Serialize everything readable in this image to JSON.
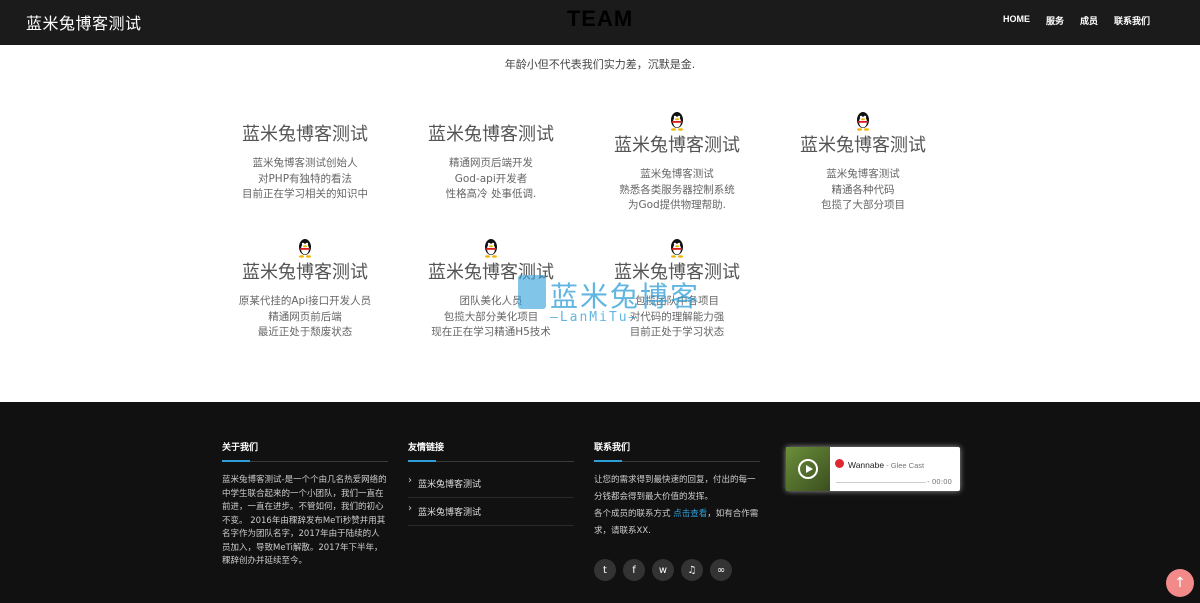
{
  "header": {
    "brand": "蓝米兔博客测试",
    "title": "TEAM",
    "nav": [
      "HOME",
      "服务",
      "成员",
      "联系我们"
    ]
  },
  "tagline": "年龄小但不代表我们实力差，沉默是金.",
  "members": [
    {
      "name": "蓝米兔博客测试",
      "lines": [
        "蓝米兔博客测试创始人",
        "对PHP有独特的看法",
        "目前正在学习相关的知识中"
      ],
      "avatar": false
    },
    {
      "name": "蓝米兔博客测试",
      "lines": [
        "精通网页后端开发",
        "God-api开发者",
        "性格高冷 处事低调."
      ],
      "avatar": false
    },
    {
      "name": "蓝米兔博客测试",
      "lines": [
        "蓝米兔博客测试",
        "熟悉各类服务器控制系统",
        "为God提供物理帮助."
      ],
      "avatar": true
    },
    {
      "name": "蓝米兔博客测试",
      "lines": [
        "蓝米兔博客测试",
        "精通各种代码",
        "包揽了大部分项目"
      ],
      "avatar": true
    },
    {
      "name": "蓝米兔博客测试",
      "lines": [
        "原某代挂的Api接口开发人员",
        "精通网页前后端",
        "最近正处于颓废状态"
      ],
      "avatar": true
    },
    {
      "name": "蓝米兔博客测试",
      "lines": [
        "团队美化人员",
        "包揽大部分美化项目",
        "现在正在学习精通H5技术"
      ],
      "avatar": true
    },
    {
      "name": "蓝米兔博客测试",
      "lines": [
        "包揽团队中各项目",
        "对代码的理解能力强",
        "目前正处于学习状态"
      ],
      "avatar": true
    }
  ],
  "watermark": {
    "main": "蓝米兔博客",
    "sub": "—LanMiTu—"
  },
  "footer": {
    "about_title": "关于我们",
    "about_text": "蓝米兔博客测试-是一个个由几名热爱网络的中学生联合起来的一个小团队，我们一直在前进，一直在进步。不管如何，我们的初心不变。 2016年由稞辞发布MeTi秒赞并用其名字作为团队名字，2017年由于陆续的人员加入，导致MeTi解散。2017年下半年，稞辞创办并延续至今。",
    "links_title": "友情链接",
    "links": [
      "蓝米兔博客测试",
      "蓝米兔博客测试"
    ],
    "contact_title": "联系我们",
    "contact_line1": "让您的需求得到最快速的回复，付出的每一分钱都会得到最大价值的发挥。",
    "contact_line2_pre": "各个成员的联系方式",
    "contact_link": "点击查看",
    "contact_line2_post": "，如有合作需求，请联系XX.",
    "socials": [
      "twitter-icon",
      "facebook-icon",
      "weibo-icon",
      "music-icon",
      "qq-weibo-icon"
    ]
  },
  "player": {
    "song": "Wannabe",
    "artist": " - Glee Cast",
    "time": "- 00:00"
  },
  "colors": {
    "accent": "#2d9ed8",
    "header_bg": "#1b1b1b",
    "footer_bg": "#111111",
    "totop": "#f28a8a"
  }
}
